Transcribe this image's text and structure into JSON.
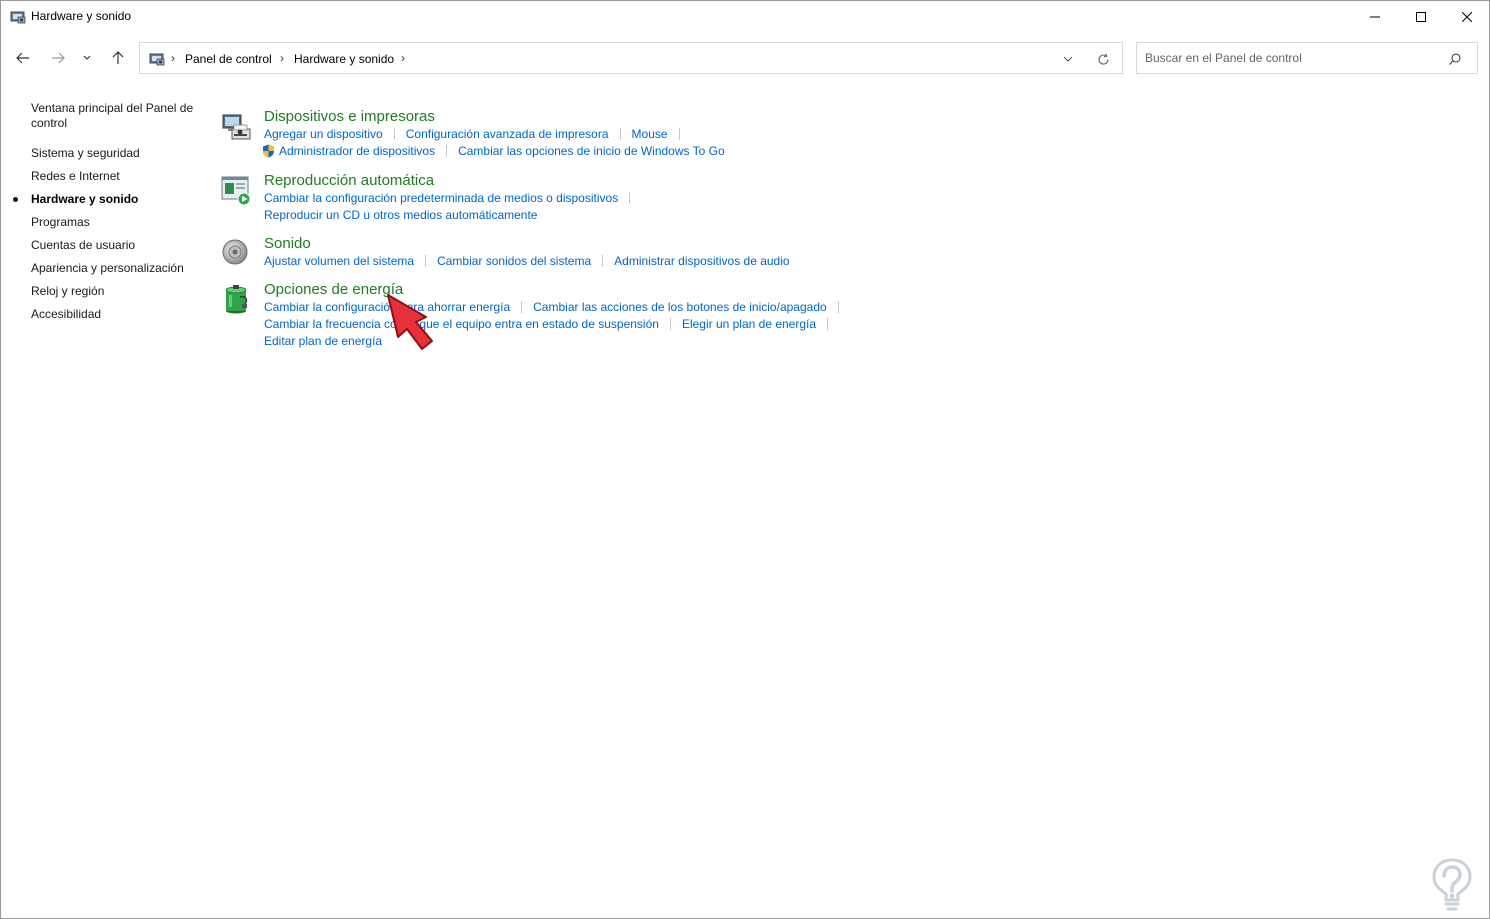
{
  "window": {
    "title": "Hardware y sonido",
    "icon": "control-panel-icon"
  },
  "address_bar": {
    "breadcrumbs": [
      "Panel de control",
      "Hardware y sonido"
    ]
  },
  "search": {
    "placeholder": "Buscar en el Panel de control"
  },
  "sidebar": {
    "items": [
      {
        "label": "Ventana principal del Panel de control",
        "active": false
      },
      {
        "label": "Sistema y seguridad",
        "active": false
      },
      {
        "label": "Redes e Internet",
        "active": false
      },
      {
        "label": "Hardware y sonido",
        "active": true
      },
      {
        "label": "Programas",
        "active": false
      },
      {
        "label": "Cuentas de usuario",
        "active": false
      },
      {
        "label": "Apariencia y personalización",
        "active": false
      },
      {
        "label": "Reloj y región",
        "active": false
      },
      {
        "label": "Accesibilidad",
        "active": false
      }
    ]
  },
  "categories": [
    {
      "title": "Dispositivos e impresoras",
      "icon": "devices-printers-icon",
      "tasks": [
        [
          "Agregar un dispositivo",
          "Configuración avanzada de impresora",
          "Mouse"
        ],
        [
          "Administrador de dispositivos",
          "Cambiar las opciones de inicio de Windows To Go"
        ]
      ]
    },
    {
      "title": "Reproducción automática",
      "icon": "autoplay-icon",
      "tasks": [
        [
          "Cambiar la configuración predeterminada de medios o dispositivos"
        ],
        [
          "Reproducir un CD u otros medios automáticamente"
        ]
      ]
    },
    {
      "title": "Sonido",
      "icon": "speaker-icon",
      "tasks": [
        [
          "Ajustar volumen del sistema",
          "Cambiar sonidos del sistema",
          "Administrar dispositivos de audio"
        ]
      ]
    },
    {
      "title": "Opciones de energía",
      "icon": "battery-power-icon",
      "tasks": [
        [
          "Cambiar la configuración para ahorrar energía",
          "Cambiar las acciones de los botones de inicio/apagado"
        ],
        [
          "Cambiar la frecuencia con la que el equipo entra en estado de suspensión",
          "Elegir un plan de energía"
        ],
        [
          "Editar plan de energía"
        ]
      ]
    }
  ],
  "colors": {
    "category_title": "#1e7e1e",
    "task_link": "#0066cc",
    "pointer_arrow": "#e8303a"
  }
}
